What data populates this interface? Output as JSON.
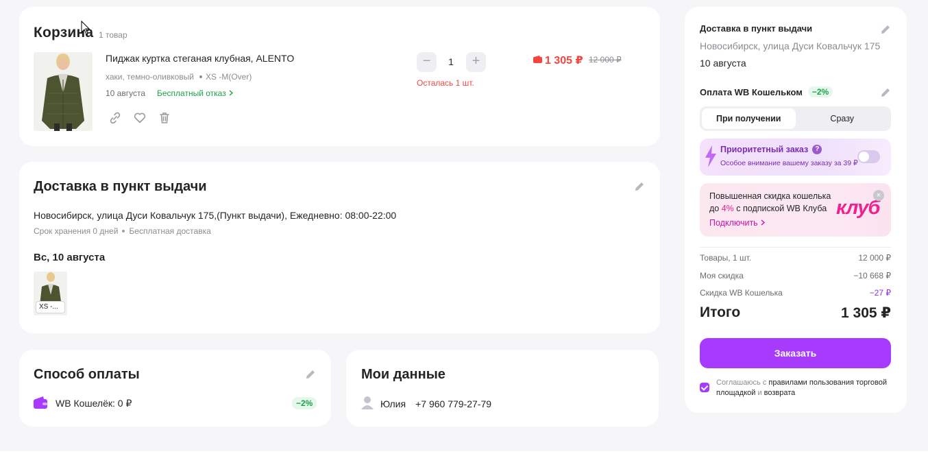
{
  "cart": {
    "title": "Корзина",
    "count": "1 товар",
    "item": {
      "name": "Пиджак куртка стеганая клубная, ALENTO",
      "color": "хаки, темно-оливковый",
      "size": "XS -M(Over)",
      "date": "10 августа",
      "free_cancel": "Бесплатный отказ",
      "qty_minus": "−",
      "qty": "1",
      "qty_plus": "+",
      "stock": "Осталась 1 шт.",
      "price": "1 305 ₽",
      "old_price": "12 000 ₽"
    },
    "icons": [
      "link-icon",
      "heart-icon",
      "trash-icon"
    ]
  },
  "delivery": {
    "title": "Доставка в пункт выдачи",
    "address": "Новосибирск, улица Дуси Ковальчук 175,(Пункт выдачи), Ежедневно: 08:00-22:00",
    "storage": "Срок хранения 0 дней",
    "free": "Бесплатная доставка",
    "day": "Вс, 10 августа",
    "size_badge": "XS -..."
  },
  "payment": {
    "title": "Способ оплаты",
    "wallet": "WB Кошелёк: 0 ₽",
    "discount": "−2%"
  },
  "mydata": {
    "title": "Мои данные",
    "name": "Юлия",
    "phone": "+7 960 779-27-79"
  },
  "summary": {
    "delivery_head": "Доставка в пункт выдачи",
    "address": "Новосибирск, улица Дуси Ковальчук 175",
    "date": "10 августа",
    "pay_head": "Оплата WB Кошельком",
    "pay_discount": "−2%",
    "seg_on_receive": "При получении",
    "seg_now": "Сразу",
    "prio_title": "Приоритетный заказ",
    "prio_q": "?",
    "prio_sub": "Особое внимание вашему заказу за 39 ₽",
    "club_line1": "Повышенная скидка кошелька",
    "club_line2_pre": "до ",
    "club_line2_pct": "4%",
    "club_line2_post": " с подпиской WB Клуба",
    "club_link": "Подключить",
    "club_logo": "клуб",
    "rows": [
      {
        "label": "Товары, 1 шт.",
        "value": "12 000 ₽"
      },
      {
        "label": "Моя скидка",
        "value": "−10 668 ₽"
      },
      {
        "label": "Скидка WB Кошелька",
        "value": "−27 ₽"
      }
    ],
    "total_label": "Итого",
    "total_value": "1 305 ₽",
    "order_btn": "Заказать",
    "agree_pre": "Соглашаюсь с ",
    "agree_link": "правилами пользования торговой площадкой",
    "agree_mid": " и ",
    "agree_link2": "возврата"
  },
  "colors": {
    "accent": "#a73afd",
    "price_red": "#f5453f",
    "green": "#1ca34a",
    "pink": "#f0218f"
  }
}
